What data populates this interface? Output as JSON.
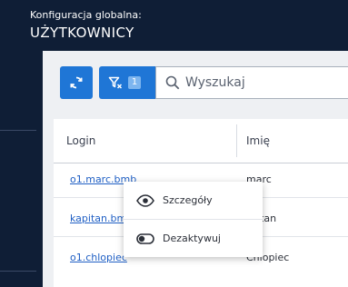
{
  "header": {
    "subtitle": "Konfiguracja globalna:",
    "title": "UŻYTKOWNICY"
  },
  "toolbar": {
    "refresh_icon": "refresh-icon",
    "filter_icon": "filter-clear-icon",
    "filter_count": "1",
    "search_placeholder": "Wyszukaj"
  },
  "table": {
    "columns": [
      "Login",
      "Imię"
    ],
    "rows": [
      {
        "login": "o1.marc.bmb",
        "name": "marc"
      },
      {
        "login": "kapitan.bm",
        "name": "pitan"
      },
      {
        "login": "o1.chlopiec",
        "name": "Chlopiec"
      }
    ]
  },
  "context_menu": {
    "items": [
      {
        "label": "Szczegóły",
        "icon": "eye-icon"
      },
      {
        "label": "Dezaktywuj",
        "icon": "toggle-off-icon"
      }
    ]
  },
  "colors": {
    "sidebar": "#0f1e36",
    "primary": "#1f76d6",
    "link": "#1f5fc4"
  }
}
